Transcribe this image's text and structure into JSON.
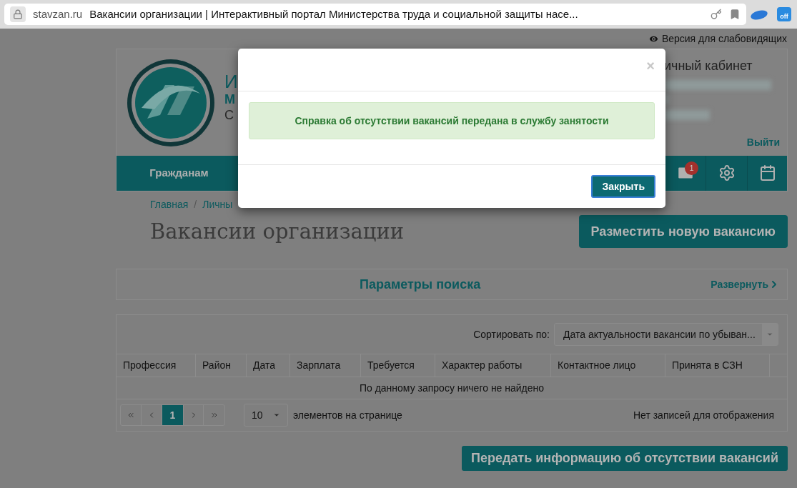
{
  "browser": {
    "domain": "stavzan.ru",
    "title": "Вакансии организации | Интерактивный портал Министерства труда и социальной защиты насе...",
    "extension_badge": "off"
  },
  "accessibility_link": "Версия для слабовидящих",
  "header": {
    "title_fragments": [
      "И",
      "М",
      "С"
    ],
    "account_title": "ичный кабинет",
    "logout": "Выйти",
    "nav": [
      {
        "kind": "text",
        "label": "Гражданам"
      },
      {
        "kind": "mail",
        "badge": "1"
      },
      {
        "kind": "settings"
      },
      {
        "kind": "calendar"
      }
    ]
  },
  "breadcrumb": [
    "Главная",
    "Личны"
  ],
  "breadcrumb_separator": "/",
  "heading": "Вакансии организации",
  "new_vacancy_button": "Разместить новую вакансию",
  "search_panel": {
    "title": "Параметры поиска",
    "expand_link": "Развернуть"
  },
  "grid": {
    "sort_label": "Сортировать по:",
    "sort_value": "Дата актуальности вакансии по убыван...",
    "columns": [
      "Профессия",
      "Район",
      "Дата",
      "Зарплата",
      "Требуется",
      "Характер работы",
      "Контактное лицо",
      "Принята в СЗН"
    ],
    "empty_message": "По данному запросу ничего не найдено",
    "pages": [
      {
        "label": "1",
        "selected": true
      }
    ],
    "page_size": "10",
    "page_size_label": "элементов на странице",
    "status": "Нет записей для отображения"
  },
  "submit_button": "Передать информацию об отсутствии вакансий",
  "modal": {
    "close_char": "×",
    "message": "Справка об отсутствии вакансий передана в службу занятости",
    "close_button": "Закрыть"
  }
}
